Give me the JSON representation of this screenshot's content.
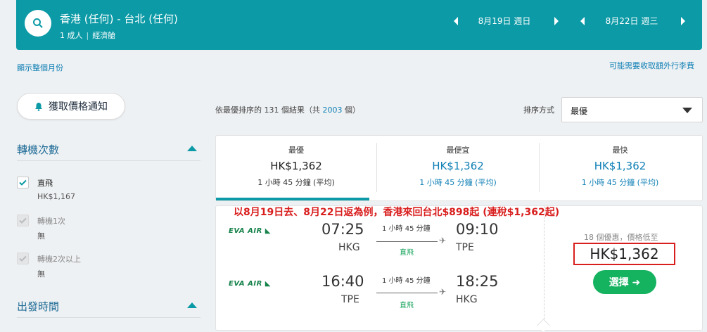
{
  "header": {
    "route": "香港 (任何) - 台北 (任何)",
    "passengers": "1 成人",
    "cabin": "經濟艙",
    "depart_date": "8月19日 週日",
    "return_date": "8月22日 週三"
  },
  "links": {
    "show_month": "顯示整個月份",
    "baggage_fee": "可能需要收取額外行李費"
  },
  "sidebar": {
    "price_alert": "獲取價格通知",
    "stops_title": "轉機次數",
    "stops": [
      {
        "label": "直飛",
        "sub": "HK$1,167",
        "checked": true
      },
      {
        "label": "轉機1次",
        "sub": "無",
        "checked": true
      },
      {
        "label": "轉機2次以上",
        "sub": "無",
        "checked": true
      }
    ],
    "depart_time_title": "出發時間"
  },
  "results": {
    "prefix": "依最優排序的 ",
    "count": "131",
    "mid": " 個結果（共 ",
    "total": "2003",
    "suffix": " 個）"
  },
  "sort": {
    "label": "排序方式",
    "value": "最優"
  },
  "tabs": [
    {
      "title": "最優",
      "price": "HK$1,362",
      "duration": "1 小時 45 分鐘 (平均)"
    },
    {
      "title": "最便宜",
      "price": "HK$1,362",
      "duration": "1 小時 45 分鐘 (平均)"
    },
    {
      "title": "最快",
      "price": "HK$1,362",
      "duration": "1 小時 45 分鐘 (平均)"
    }
  ],
  "promo_text": "以8月19日去、8月22日返為例，香港來回台北$898起 (連稅$1,362起)",
  "flight": {
    "airline": "EVA AIR",
    "outbound": {
      "dep_time": "07:25",
      "dep_apt": "HKG",
      "duration": "1 小時 45 分鐘",
      "type": "直飛",
      "arr_time": "09:10",
      "arr_apt": "TPE"
    },
    "inbound": {
      "dep_time": "16:40",
      "dep_apt": "TPE",
      "duration": "1 小時 45 分鐘",
      "type": "直飛",
      "arr_time": "18:25",
      "arr_apt": "HKG"
    },
    "deals": "18 個優惠，價格低至",
    "price": "HK$1,362",
    "select": "選擇 ➜"
  },
  "colors": {
    "brand": "#0b9aa6",
    "link": "#0f7fb5",
    "select": "#15b25f",
    "promo": "#d91e1e"
  }
}
